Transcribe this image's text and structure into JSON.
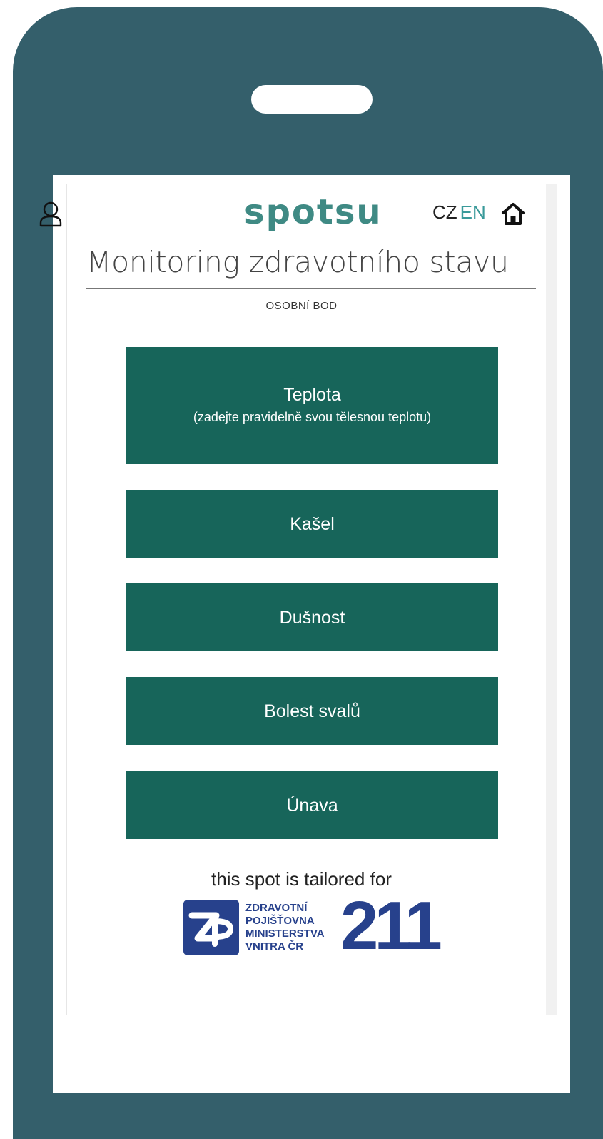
{
  "header": {
    "logo": "spotsu",
    "lang_cz": "CZ",
    "lang_en": "EN",
    "user_icon": "user-icon",
    "home_icon": "home-icon"
  },
  "page": {
    "title": "Monitoring zdravotního stavu",
    "subtitle": "OSOBNÍ BOD"
  },
  "menu": [
    {
      "label": "Teplota",
      "hint": "(zadejte pravidelně svou tělesnou teplotu)"
    },
    {
      "label": "Kašel"
    },
    {
      "label": "Dušnost"
    },
    {
      "label": "Bolest svalů"
    },
    {
      "label": "Únava"
    }
  ],
  "footer": {
    "text": "this spot is tailored for",
    "partner_lines": [
      "ZDRAVOTNÍ",
      "POJIŠŤOVNA",
      "MINISTERSTVA",
      "VNITRA ČR"
    ],
    "partner_number": "211"
  },
  "colors": {
    "frame": "#345f6b",
    "button": "#17655a",
    "logo": "#3f8a84",
    "lang_active": "#3a9a9a",
    "partner": "#27418c"
  }
}
